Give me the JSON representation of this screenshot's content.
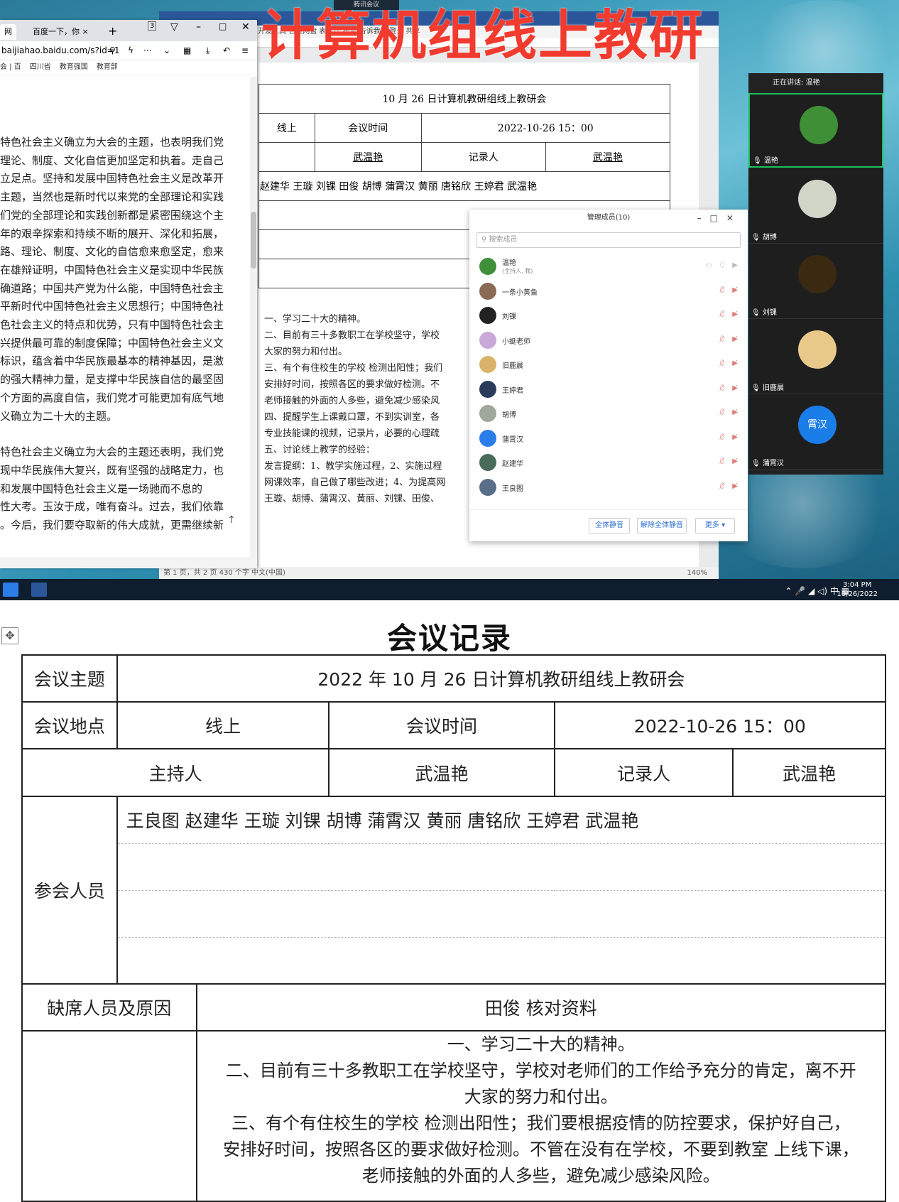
{
  "overlay": {
    "title": "计算机组线上教研",
    "meeting_tag": "腾讯会议"
  },
  "browser": {
    "tabs": [
      "百度一下，你",
      "3"
    ],
    "tab_prefix": "网",
    "address": "baijiahao.baidu.com/s?id=1",
    "bookmarks": [
      "会 | 百",
      "四川省",
      "教育强国",
      "教育部"
    ],
    "article": [
      [
        "特色社会主义确立为大会的主题，也表明我们党",
        "理论、制度、文化自信更加坚定和执着。走自己",
        "立足点。坚持和发展中国特色社会主义是改革开",
        "主题，当然也是新时代以来党的全部理论和实践",
        "们党的全部理论和实践创新都是紧密围绕这个主",
        "年的艰辛探索和持续不断的展开、深化和拓展，",
        "路、理论、制度、文化的自信愈来愈坚定，愈来",
        "在雄辩证明，中国特色社会主义是实现中华民族",
        "确道路；中国共产党为什么能，中国特色社会主",
        "平新时代中国特色社会主义思想行；中国特色社",
        "色社会主义的特点和优势，只有中国特色社会主",
        "兴提供最可靠的制度保障；中国特色社会主义文",
        "标识，蕴含着中华民族最基本的精神基因，是激",
        "的强大精神力量，是支撑中华民族自信的最坚固",
        "个方面的高度自信，我们党才可能更加有底气地",
        "义确立为二十大的主题。"
      ],
      [
        "特色社会主义确立为大会的主题还表明，我们党",
        "现中华民族伟大复兴，既有坚强的战略定力，也",
        "和发展中国特色社会主义是一场驰而不息的",
        "性大考。玉汝于成，唯有奋斗。过去，我们依靠",
        "。今后，我们要夺取新的伟大成就，更需继续新"
      ]
    ]
  },
  "word": {
    "ribbon_items": "设计  布局  引用  邮件  审阅  视图  开发工具  百度网盘  表设计  布局  告诉我...  登录  共享",
    "doc_heading": "10 月 26 日计算机教研组线上教研会",
    "row2": [
      "线上",
      "会议时间",
      "2022-10-26 15：00"
    ],
    "row3": [
      "",
      "武温艳",
      "记录人",
      "武温艳"
    ],
    "attendees": "赵建华 王璇 刘锞 田俊 胡博 蒲霄汉 黄丽 唐铭欣 王婷君 武温艳",
    "body_lines": [
      "一、学习二十大的精神。",
      "二、目前有三十多教职工在学校坚守，学校",
      "大家的努力和付出。",
      "三、有个有住校生的学校 检测出阳性；我们",
      "安排好时间，按照各区的要求做好检测。不",
      "老师接触的外面的人多些，避免减少感染风",
      "四、提醒学生上课戴口罩，不到实训室，各",
      "专业技能课的视频，记录片，必要的心理疏",
      "五、讨论线上教学的经验：",
      "发言提纲：1、教学实施过程，2、实施过程",
      "网课效率，自己做了哪些改进；4、为提高网",
      "王璇、胡博、蒲霄汉、黄丽、刘锞、田俊、"
    ],
    "status": "第 1 页，共 2 页    430 个字    中文(中国)",
    "zoom": "140%"
  },
  "members": {
    "title": "管理成员(10)",
    "search_placeholder": "搜索成员",
    "list": [
      {
        "name": "温艳",
        "sub": "(主持人, 我)",
        "color": "#3f8f3a"
      },
      {
        "name": "一条小黄鱼",
        "sub": "",
        "color": "#8a6a55"
      },
      {
        "name": "刘锞",
        "sub": "",
        "color": "#222222"
      },
      {
        "name": "小蜓老师",
        "sub": "",
        "color": "#c8a9d8"
      },
      {
        "name": "旧鹿晨",
        "sub": "",
        "color": "#d9b36a"
      },
      {
        "name": "王婷君",
        "sub": "",
        "color": "#2a3a5a"
      },
      {
        "name": "胡博",
        "sub": "",
        "color": "#9fa89a"
      },
      {
        "name": "蒲霄汉",
        "sub": "",
        "color": "#2b7de9"
      },
      {
        "name": "赵建华",
        "sub": "",
        "color": "#4a6a5a"
      },
      {
        "name": "王良图",
        "sub": "",
        "color": "#5a6e8a"
      }
    ],
    "footer_buttons": [
      "全体静音",
      "解除全体静音",
      "更多 ▾"
    ]
  },
  "video": {
    "speaking": "正在讲话: 温艳",
    "tiles": [
      {
        "name": "温艳",
        "color": "#3e8f35"
      },
      {
        "name": "胡博",
        "color": "#cfd6c8"
      },
      {
        "name": "刘锞",
        "color": "#3b2a12"
      },
      {
        "name": "旧鹿晨",
        "color": "#e8c98a"
      },
      {
        "name": "蒲霄汉",
        "color": "#1a7de8",
        "initials": "霄汉"
      }
    ]
  },
  "taskbar": {
    "ime": "中",
    "time": "3:04 PM",
    "date": "10/26/2022"
  },
  "record": {
    "title": "会议记录",
    "topic_label": "会议主题",
    "topic_value": "2022 年 10 月 26 日计算机教研组线上教研会",
    "place_label": "会议地点",
    "place_value": "线上",
    "time_label": "会议时间",
    "time_value": "2022-10-26 15：00",
    "host_label": "主持人",
    "host_value": "武温艳",
    "recorder_label": "记录人",
    "recorder_value": "武温艳",
    "attendees_label": "参会人员",
    "attendees_value": "王良图  赵建华  王璇  刘锞  胡博  蒲霄汉  黄丽  唐铭欣  王婷君  武温艳",
    "absent_label": "缺席人员及原因",
    "absent_value": "田俊  核对资料",
    "content_lines": [
      "一、学习二十大的精神。",
      "二、目前有三十多教职工在学校坚守，学校对老师们的工作给予充分的肯定，离不开",
      "大家的努力和付出。",
      "三、有个有住校生的学校 检测出阳性；我们要根据疫情的防控要求，保护好自己，",
      "安排好时间，按照各区的要求做好检测。不管在没有在学校，不要到教室  上线下课，",
      "老师接触的外面的人多些，避免减少感染风险。"
    ]
  }
}
